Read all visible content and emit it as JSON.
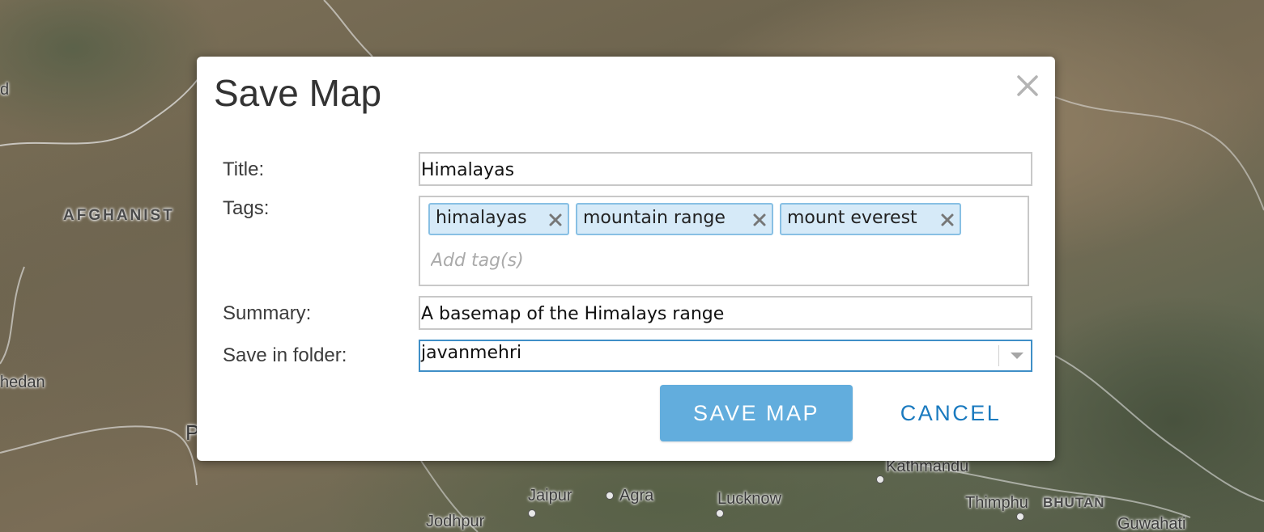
{
  "map": {
    "labels": {
      "afghanistan": "AFGHANIST",
      "zahedan": "hedan",
      "kathmandu": "Kathmandu",
      "jaipur": "Jaipur",
      "agra": "Agra",
      "lucknow": "Lucknow",
      "thimphu": "Thimphu",
      "bhutan": "BHUTAN",
      "jodhpur": "Jodhpur",
      "guwahati": "Guwahati",
      "left_fragment": "d",
      "p_fragment": "P"
    }
  },
  "dialog": {
    "title": "Save Map",
    "close_icon": "close-icon",
    "fields": {
      "title": {
        "label": "Title:",
        "value": "Himalayas"
      },
      "tags": {
        "label": "Tags:",
        "items": [
          "himalayas",
          "mountain range",
          "mount everest"
        ],
        "remove_icon": "close-icon",
        "placeholder": "Add tag(s)"
      },
      "summary": {
        "label": "Summary:",
        "value": "A basemap of the Himalays range"
      },
      "folder": {
        "label": "Save in folder:",
        "value": "javanmehri",
        "arrow_icon": "caret-down-icon"
      }
    },
    "buttons": {
      "save": "SAVE MAP",
      "cancel": "CANCEL"
    }
  },
  "colors": {
    "primary_button": "#62addd",
    "link": "#1a7abf",
    "tag_background": "#d6eaf8",
    "tag_border": "#88c0e4",
    "focus_border": "#3f8fc7"
  }
}
